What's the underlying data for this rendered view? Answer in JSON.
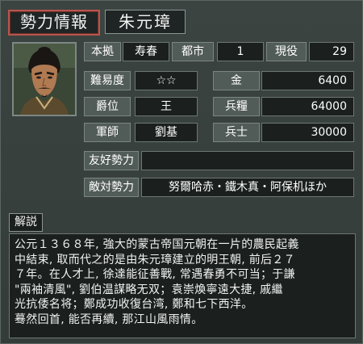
{
  "header": {
    "title": "勢力情報",
    "ruler_name": "朱元璋"
  },
  "stats": {
    "base_label": "本拠",
    "base_value": "寿春",
    "cities_label": "都市",
    "cities_value": "1",
    "active_label": "現役",
    "active_value": "29",
    "difficulty_label": "難易度",
    "difficulty_value": "☆☆",
    "gold_label": "金",
    "gold_value": "6400",
    "rank_label": "爵位",
    "rank_value": "王",
    "food_label": "兵糧",
    "food_value": "64000",
    "advisor_label": "軍師",
    "advisor_value": "劉基",
    "soldiers_label": "兵士",
    "soldiers_value": "30000"
  },
  "relations": {
    "friendly_label": "友好勢力",
    "friendly_value": "",
    "hostile_label": "敵対勢力",
    "hostile_value": "努爾哈赤・鐵木真・阿保机ほか"
  },
  "description": {
    "header": "解説",
    "lines": [
      "公元１３６８年, 強大的蒙古帝国元朝在一片的農民起義",
      "中結束, 取而代之的是由朱元璋建立的明王朝, 前后２７",
      "７年。在人才上, 徐達能征善戰, 常遇春勇不可当；于謙",
      "\"兩袖清風\", 劉伯温謀略无双；袁崇煥寧遠大捷, 戚繼",
      "光抗倭名将；鄭成功收復台湾, 鄭和七下西洋。",
      "蓦然回首, 能否再續, 那江山風雨情。"
    ]
  },
  "portrait": {
    "icon": "ruler-portrait-icon"
  }
}
